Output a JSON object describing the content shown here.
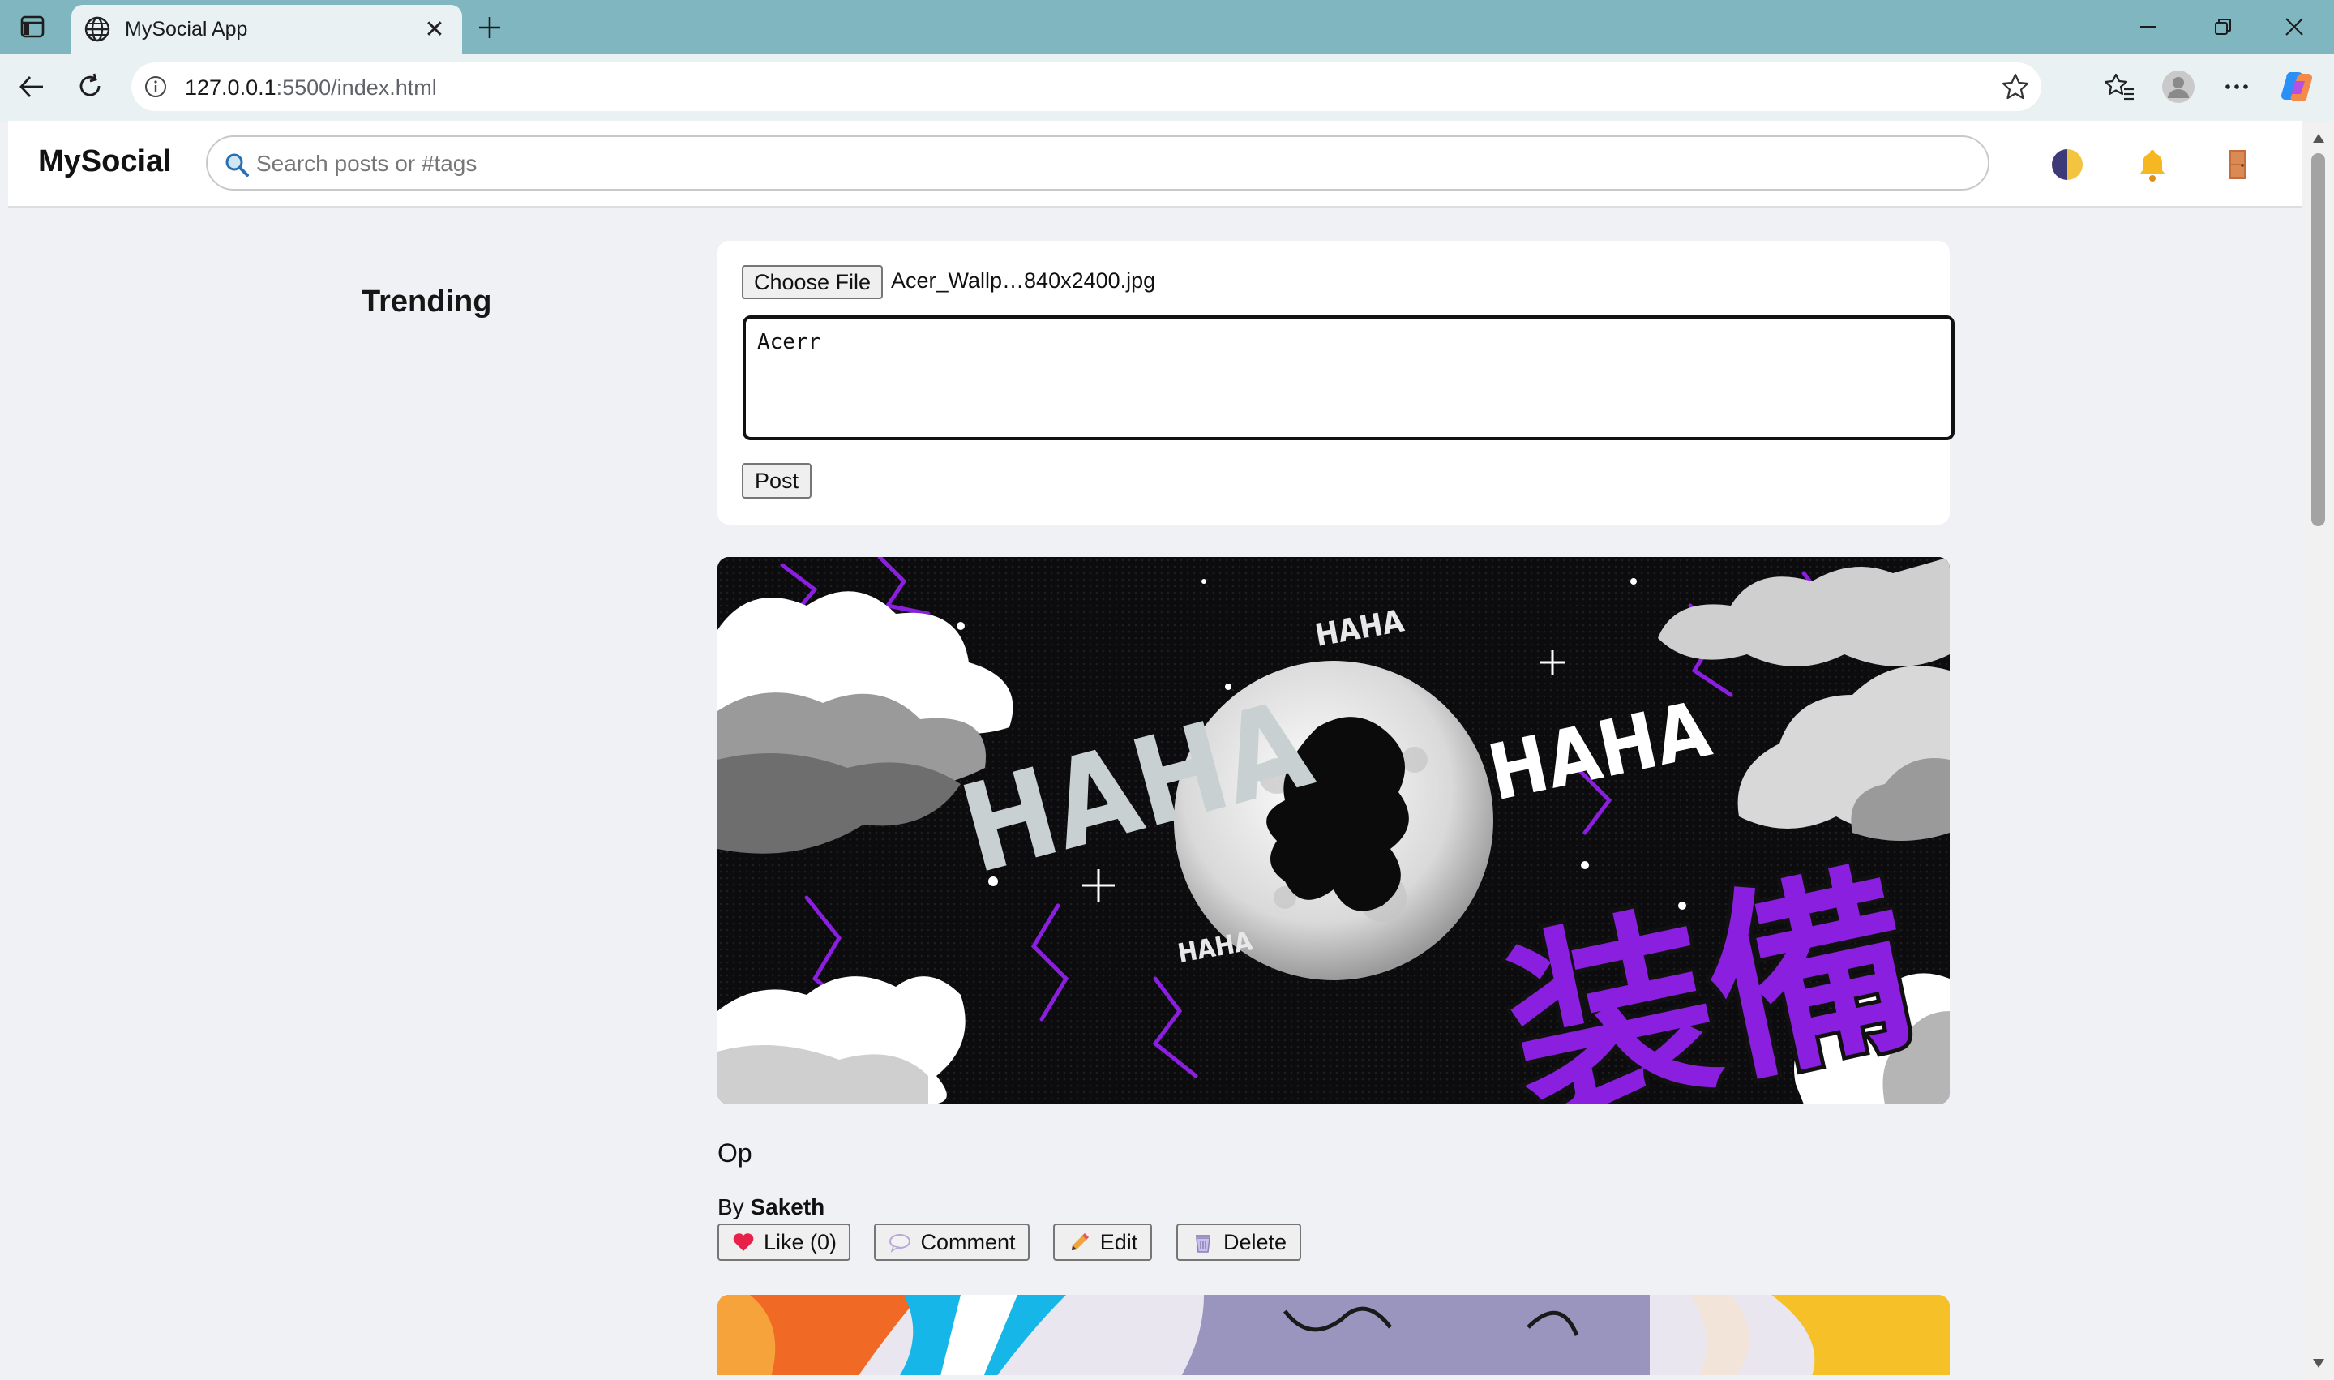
{
  "browser": {
    "tab_title": "MySocial App",
    "url_host": "127.0.0.1",
    "url_rest": ":5500/index.html"
  },
  "app": {
    "logo": "MySocial",
    "search_placeholder": "Search posts or #tags",
    "header_icons": [
      "theme-toggle-icon",
      "bell-icon",
      "door-icon"
    ]
  },
  "sidebar": {
    "title": "Trending"
  },
  "composer": {
    "file_button": "Choose File",
    "file_name": "Acer_Wallp…840x2400.jpg",
    "text_value": "Acerr",
    "post_button": "Post"
  },
  "posts": [
    {
      "caption": "Op",
      "author_prefix": "By",
      "author": "Saketh",
      "image_text": {
        "haha_large": "HAHA",
        "haha_right": "HAHA",
        "haha_top": "HAHA",
        "haha_small": "HAHA",
        "kanji": "装備"
      },
      "actions": {
        "like": "Like (0)",
        "comment": "Comment",
        "edit": "Edit",
        "delete": "Delete"
      }
    }
  ],
  "colors": {
    "titlebar": "#7fb6c0",
    "toolbar": "#e9f1f3",
    "page_bg": "#f0f1f4",
    "accent_purple": "#8a1fe0"
  }
}
